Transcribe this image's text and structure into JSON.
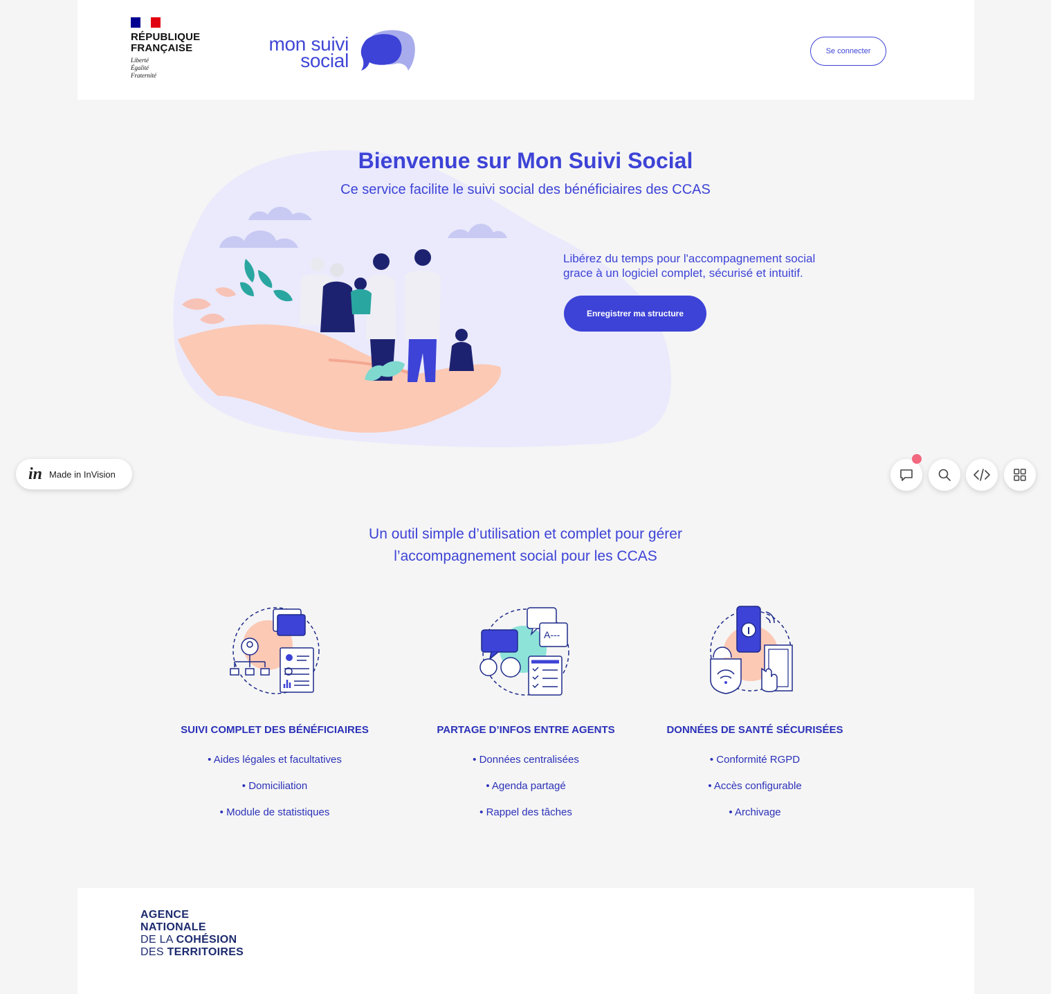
{
  "header": {
    "republique": {
      "name": "RÉPUBLIQUE\nFRANÇAISE",
      "motto": "Liberté\nÉgalité\nFraternité",
      "flag_colors": [
        "#000091",
        "#ffffff",
        "#e1000f"
      ]
    },
    "brand_name": "mon suivi\nsocial",
    "login_label": "Se connecter"
  },
  "hero": {
    "title": "Bienvenue sur Mon Suivi Social",
    "subtitle": "Ce service facilite le suivi social des bénéficiaires des CCAS",
    "copy": "Libérez du temps pour l'accompagnement social\ngrace à un logiciel complet, sécurisé et intuitif.",
    "cta_label": "Enregistrer ma structure"
  },
  "invision": {
    "logo": "in",
    "label": "Made in InVision"
  },
  "toolbar": {
    "icons": [
      "comment-icon",
      "search-icon",
      "code-icon",
      "grid-icon"
    ]
  },
  "features_section": {
    "title": "Un outil simple d’utilisation et complet pour gérer\nl’accompagnement social pour les CCAS",
    "features": [
      {
        "title": "SUIVI COMPLET DES BÉNÉFICIAIRES",
        "icon": "beneficiary-tracking-icon",
        "items": [
          "Aides légales et facultatives",
          "Domiciliation",
          "Module de statistiques"
        ]
      },
      {
        "title": "PARTAGE D’INFOS ENTRE AGENTS",
        "icon": "agent-sharing-icon",
        "items": [
          "Données centralisées",
          "Agenda partagé",
          "Rappel des tâches"
        ]
      },
      {
        "title": "DONNÉES DE SANTÉ SÉCURISÉES",
        "icon": "secure-data-icon",
        "items": [
          "Conformité RGPD",
          "Accès configurable",
          "Archivage"
        ]
      }
    ]
  },
  "footer": {
    "agency_line1": "AGENCE",
    "agency_line2": "NATIONALE",
    "agency_line3_light": "DE LA",
    "agency_line3_bold": "COHÉSION",
    "agency_line4_light": "DES",
    "agency_line4_bold": "TERRITOIRES"
  },
  "colors": {
    "primary": "#3d43d6",
    "background": "#f5f5f5",
    "blob": "#eaeafc",
    "notification": "#f2687f"
  }
}
